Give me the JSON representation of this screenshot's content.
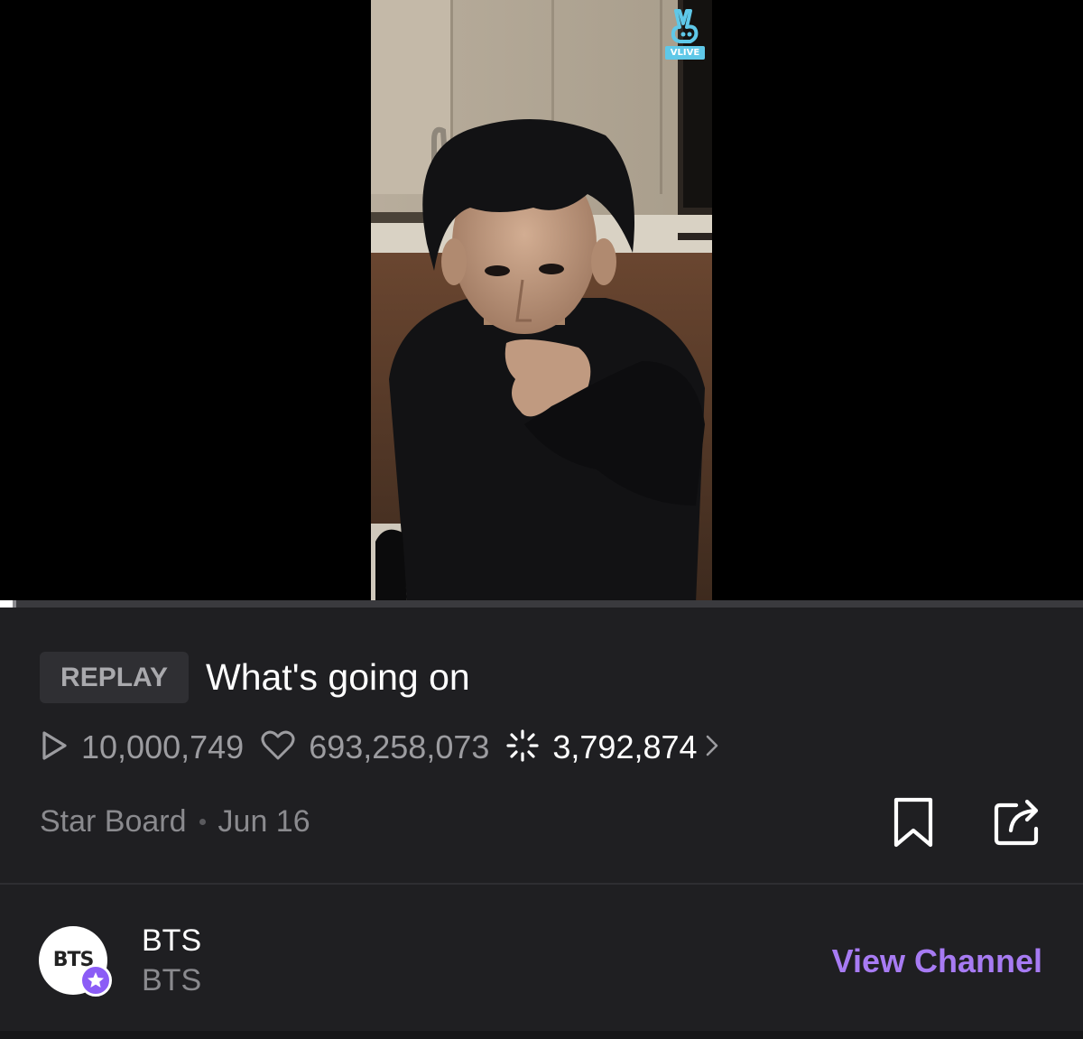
{
  "player": {
    "logo_badge_text": "VLIVE",
    "progress": {
      "played_fraction": 0.012,
      "buffered_fraction": 0.015
    }
  },
  "video": {
    "badge": "REPLAY",
    "title": "What's going on",
    "views": "10,000,749",
    "likes": "693,258,073",
    "comments": "3,792,874",
    "board": "Star Board",
    "date": "Jun 16"
  },
  "channel": {
    "avatar_text": "BTS",
    "name": "BTS",
    "subtitle": "BTS",
    "view_button": "View Channel"
  },
  "colors": {
    "background": "#1f1f22",
    "accent_purple": "#a77bf3",
    "badge_purple": "#8b5cf6",
    "vlive_blue": "#5fc8e8"
  },
  "icons": [
    "play-icon",
    "heart-icon",
    "sparkle-icon",
    "chevron-right-icon",
    "bookmark-icon",
    "share-icon",
    "star-icon",
    "vlive-logo-icon"
  ]
}
